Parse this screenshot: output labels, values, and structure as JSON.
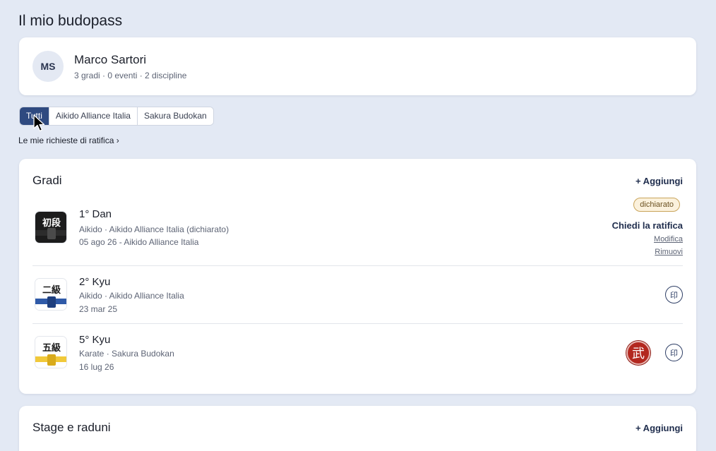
{
  "page": {
    "title": "Il mio budopass"
  },
  "profile": {
    "initials": "MS",
    "name": "Marco Sartori",
    "stats": "3 gradi · 0 eventi · 2 discipline"
  },
  "filters": {
    "tabs": [
      {
        "label": "Tutti",
        "active": true
      },
      {
        "label": "Aikido Alliance Italia",
        "active": false
      },
      {
        "label": "Sakura Budokan",
        "active": false
      }
    ]
  },
  "ratifica_link": "Le mie richieste di ratifica ›",
  "gradi": {
    "title": "Gradi",
    "add_label": "+ Aggiungi",
    "items": [
      {
        "name": "1° Dan",
        "line1": "Aikido · Aikido Alliance Italia (dichiarato)",
        "line2": "05 ago 26 - Aikido Alliance Italia",
        "icon_text": "初段",
        "icon_name": "black-belt-dan-icon",
        "badge": "dichiarato",
        "ratify_label": "Chiedi la ratifica",
        "edit_label": "Modifica",
        "remove_label": "Rimuovi"
      },
      {
        "name": "2° Kyu",
        "line1": "Aikido · Aikido Alliance Italia",
        "line2": "23 mar 25",
        "icon_text": "二級",
        "icon_name": "blue-belt-kyu-icon",
        "stamp_glyph": "印"
      },
      {
        "name": "5° Kyu",
        "line1": "Karate · Sakura Budokan",
        "line2": "16 lug 26",
        "icon_text": "五級",
        "icon_name": "yellow-belt-kyu-icon",
        "seal_glyph": "武",
        "stamp_glyph": "印"
      }
    ]
  },
  "stage": {
    "title": "Stage e raduni",
    "add_label": "+ Aggiungi"
  },
  "colors": {
    "background": "#e3e9f4",
    "accent": "#2f4a80",
    "badge_border": "#c9a45a",
    "badge_fill": "#fbf1dc",
    "seal_red": "#b3281f",
    "belt_blue": "#2f5aa8",
    "belt_yellow": "#f1c93a"
  }
}
